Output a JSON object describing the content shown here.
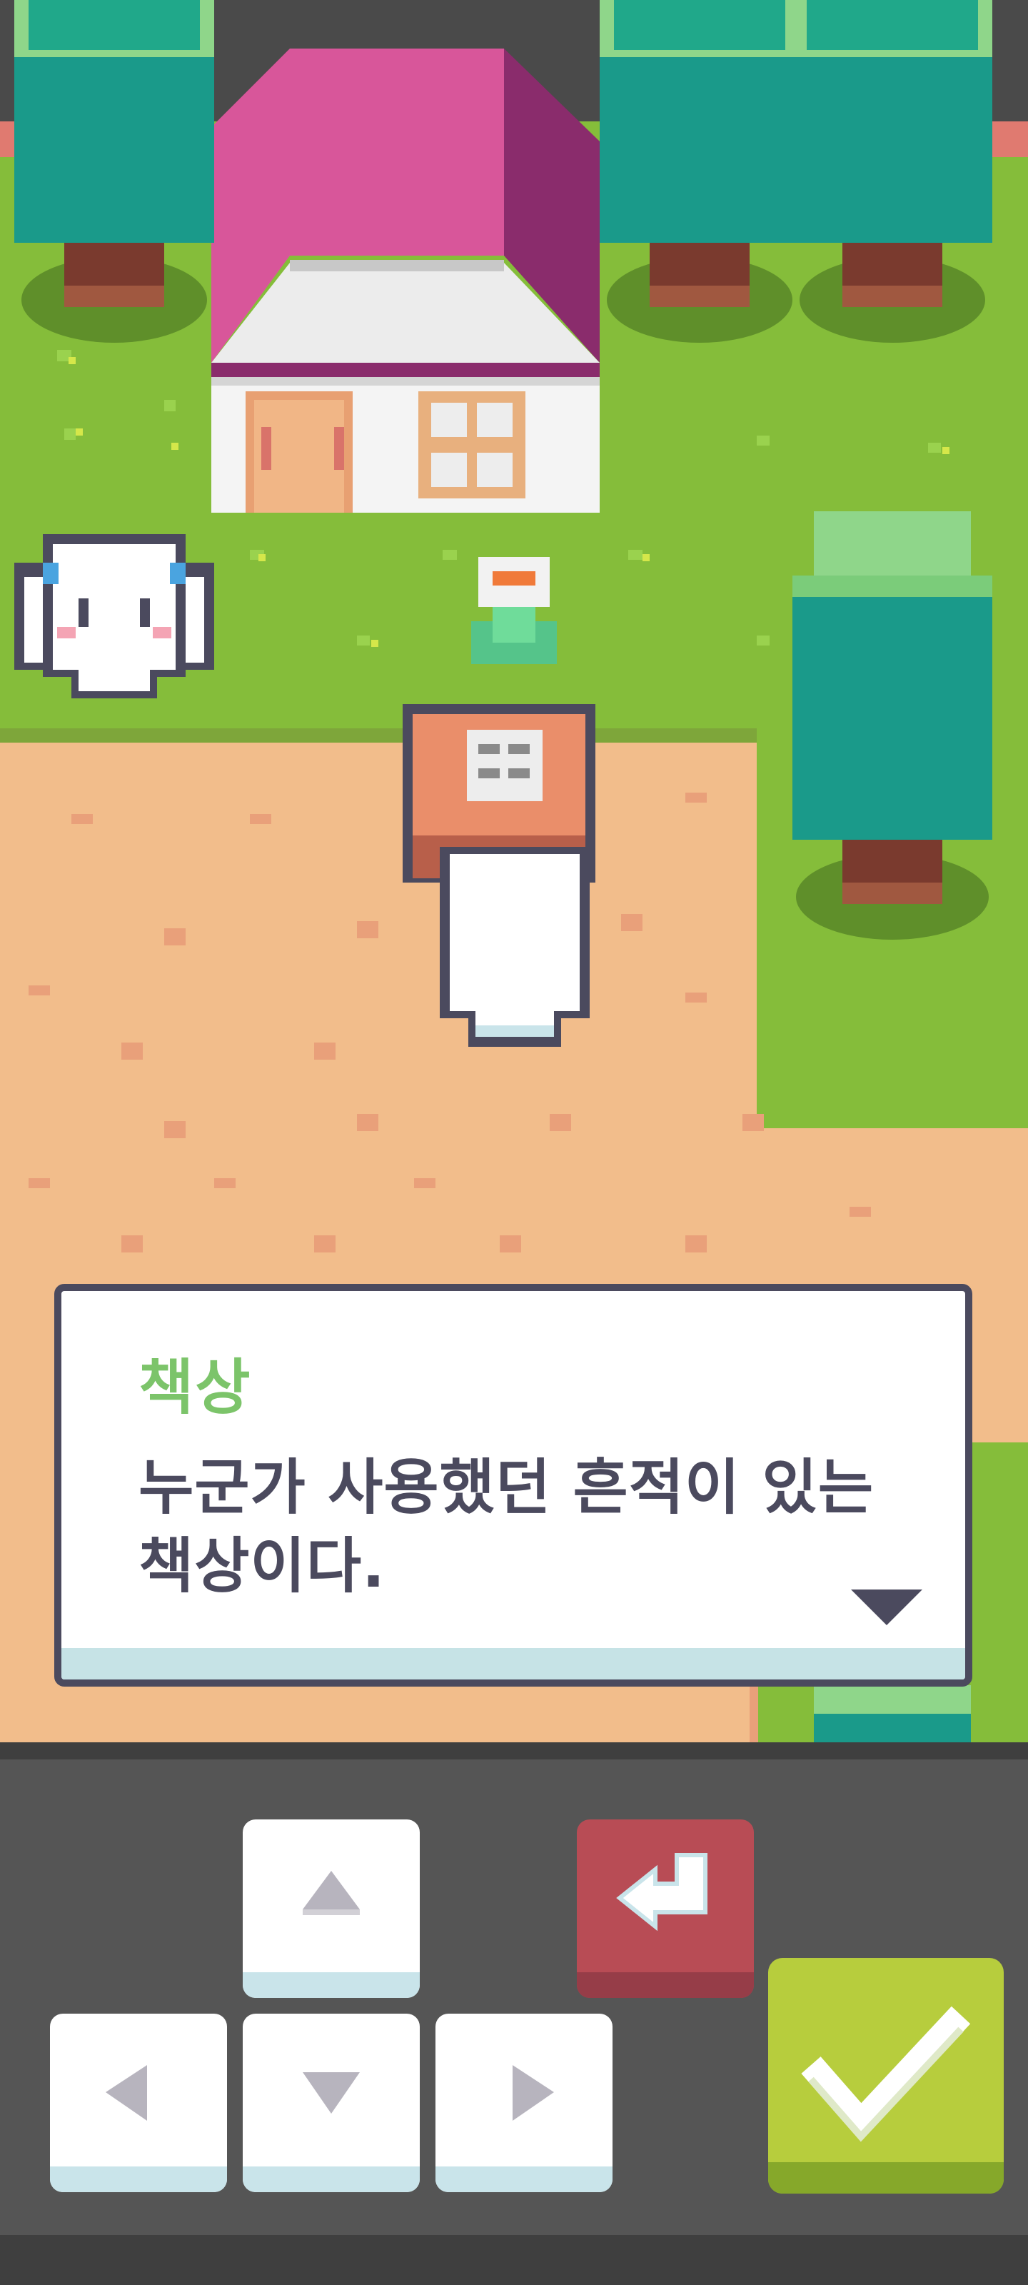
{
  "dialog": {
    "speaker": "책상",
    "lines": [
      "누군가 사용했던 흔적이 있는",
      "책상이다."
    ]
  },
  "controls": {
    "up": "up-arrow-icon",
    "down": "down-arrow-icon",
    "left": "left-arrow-icon",
    "right": "right-arrow-icon",
    "back": "return-arrow-icon",
    "confirm": "checkmark-icon"
  },
  "colors": {
    "grass": "#85bd3a",
    "dirt": "#f2bd8b",
    "roof": "#d8569a",
    "tree": "#1a9a8a",
    "dialog_border": "#4b4a5e",
    "speaker_name": "#7cc46a",
    "dialog_text": "#4b4a5e",
    "back_button": "#b84c55",
    "confirm_button": "#b7cd3d"
  }
}
